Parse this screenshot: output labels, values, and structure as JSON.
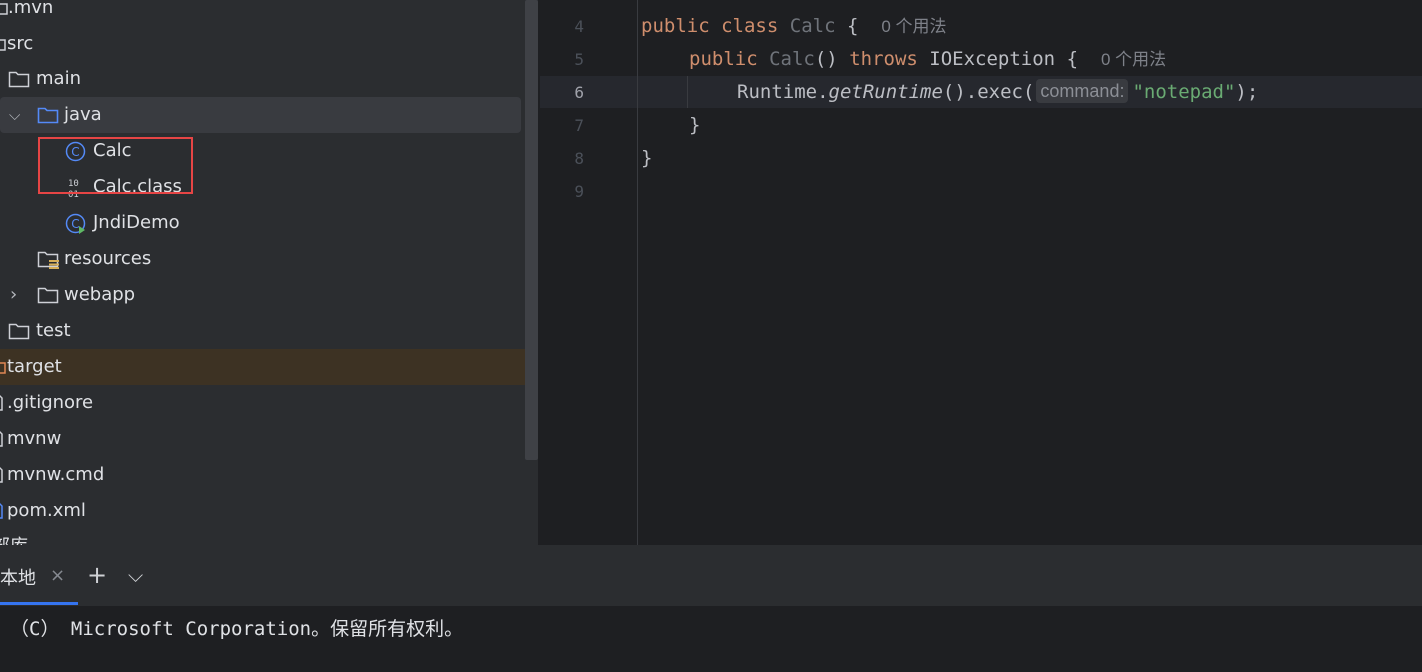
{
  "project_tree": {
    "items": [
      {
        "label": ".mvn"
      },
      {
        "label": "src"
      },
      {
        "label": "main"
      },
      {
        "label": "java"
      },
      {
        "label": "Calc"
      },
      {
        "label": "Calc.class"
      },
      {
        "label": "JndiDemo"
      },
      {
        "label": "resources"
      },
      {
        "label": "webapp"
      },
      {
        "label": "test"
      },
      {
        "label": "target"
      },
      {
        "label": ".gitignore"
      },
      {
        "label": "mvnw"
      },
      {
        "label": "mvnw.cmd"
      },
      {
        "label": "pom.xml"
      },
      {
        "label": "部库"
      }
    ],
    "icons": {
      "class_icon_letter": "C",
      "binary_top": "10",
      "binary_bottom": "01"
    }
  },
  "editor": {
    "line_numbers": [
      "4",
      "5",
      "6",
      "7",
      "8",
      "9"
    ],
    "lines": {
      "l4": {
        "kw1": "public",
        "kw2": "class",
        "name": "Calc",
        "brace": "{",
        "hint": "0 个用法"
      },
      "l5": {
        "kw1": "public",
        "name": "Calc",
        "parens": "()",
        "kw2": "throws",
        "exc": "IOException",
        "brace": "{",
        "hint": "0 个用法"
      },
      "l6": {
        "pre": "Runtime.",
        "method": "getRuntime",
        "mid": "().exec(",
        "inlay": "command:",
        "str": "\"notepad\"",
        "end": ");"
      },
      "l7": {
        "brace": "}"
      },
      "l8": {
        "brace": "}"
      }
    }
  },
  "terminal": {
    "tab_label": "本地",
    "close_glyph": "×",
    "add_glyph": "+",
    "more_glyph": "⌵",
    "output": "（C） Microsoft Corporation。保留所有权利。"
  },
  "colors": {
    "keyword": "#cf8e6d",
    "string": "#6aab73",
    "accent": "#3574f0",
    "highlight_box": "#e64545"
  }
}
